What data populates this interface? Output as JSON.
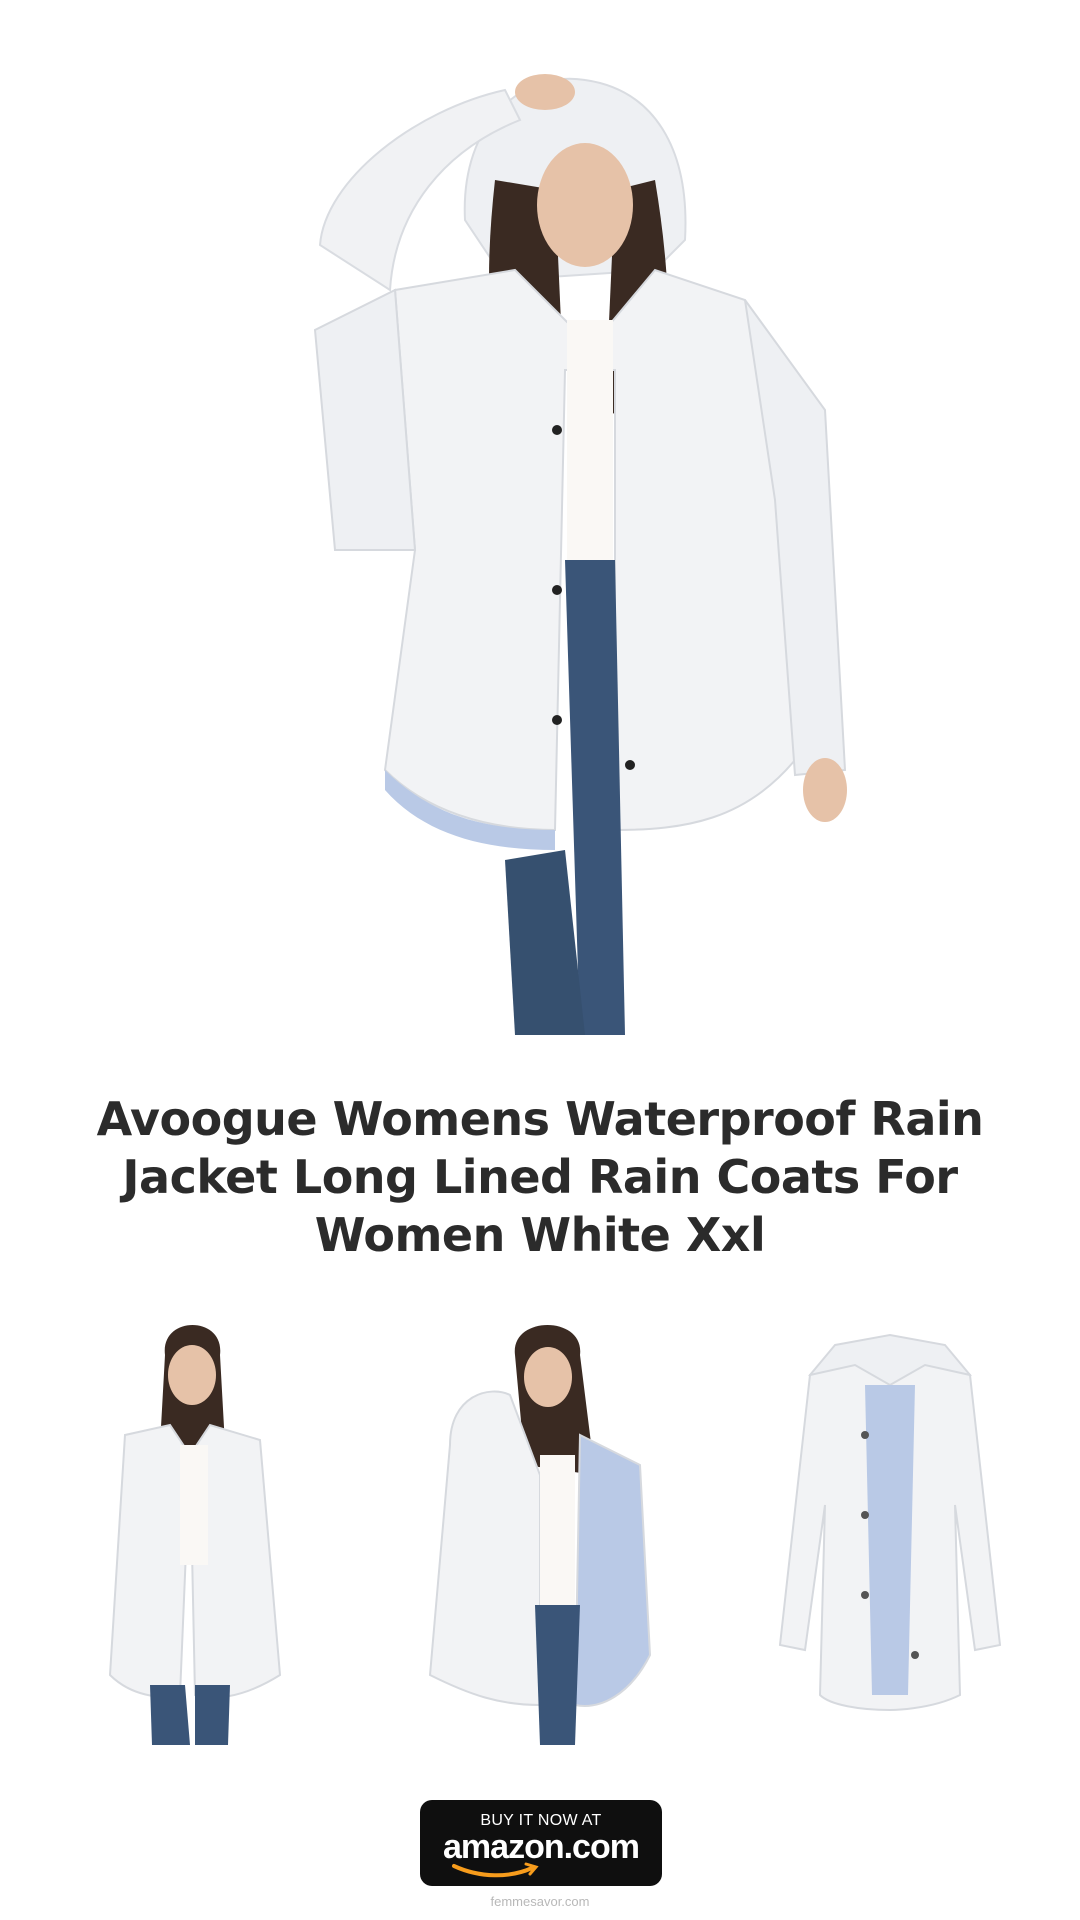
{
  "product": {
    "title": "Avoogue Womens Waterproof Rain Jacket Long Lined Rain Coats For Women White Xxl"
  },
  "images": {
    "hero": "rain-jacket-hooded-front",
    "thumbs": [
      "rain-jacket-model-front",
      "rain-jacket-model-open-lining",
      "rain-jacket-flat-lay"
    ]
  },
  "cta": {
    "top_line": "BUY IT NOW AT",
    "brand": "amazon.com"
  },
  "footer": {
    "site": "femmesavor.com"
  },
  "colors": {
    "jacket": "#f2f3f5",
    "lining": "#b9c9e6",
    "denim": "#3a5578",
    "hair": "#3a2a22",
    "title_text": "#2b2b2b",
    "button_bg": "#0f0f0f",
    "smile_accent": "#f79c1c"
  }
}
